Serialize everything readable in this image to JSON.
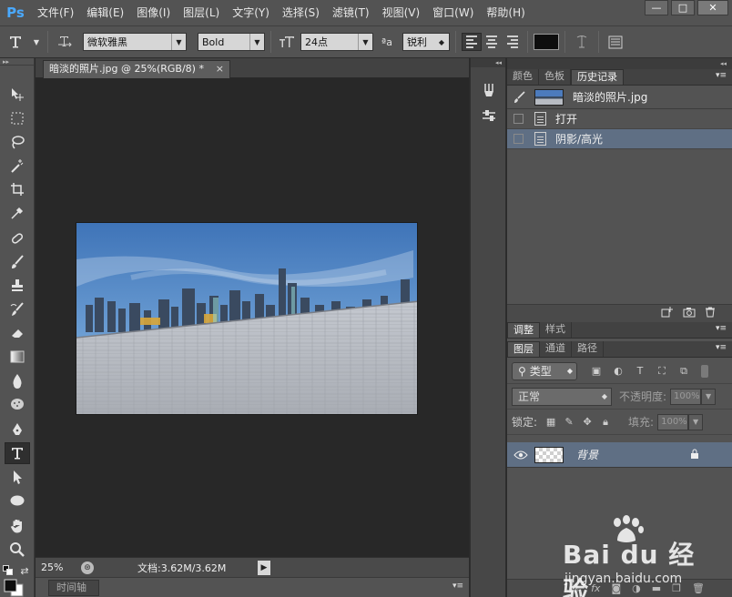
{
  "app": {
    "logo": "Ps"
  },
  "menu": [
    "文件(F)",
    "编辑(E)",
    "图像(I)",
    "图层(L)",
    "文字(Y)",
    "选择(S)",
    "滤镜(T)",
    "视图(V)",
    "窗口(W)",
    "帮助(H)"
  ],
  "window_controls": {
    "minimize": "—",
    "maximize": "□",
    "close": "✕"
  },
  "options": {
    "font_family": "微软雅黑",
    "font_style": "Bold",
    "font_size": "24点",
    "aa_label": "ªa",
    "antialias": "锐利",
    "text_color": "#0e0e0e"
  },
  "document": {
    "tab_title": "暗淡的照片.jpg @ 25%(RGB/8) *",
    "tab_close": "×",
    "zoom": "25%",
    "doc_size": "文档:3.62M/3.62M"
  },
  "timeline": {
    "label": "时间轴"
  },
  "history_panel": {
    "tabs": [
      "颜色",
      "色板",
      "历史记录"
    ],
    "active_tab": "历史记录",
    "snapshot": "暗淡的照片.jpg",
    "items": [
      {
        "label": "打开",
        "selected": false
      },
      {
        "label": "阴影/高光",
        "selected": true
      }
    ]
  },
  "adjust_tabs": [
    "调整",
    "样式"
  ],
  "layers_panel": {
    "tabs": [
      "图层",
      "通道",
      "路径"
    ],
    "filter_type": "类型",
    "blend_mode": "正常",
    "opacity_label": "不透明度:",
    "opacity_value": "100%",
    "lock_label": "锁定:",
    "fill_label": "填充:",
    "fill_value": "100%",
    "layers": [
      {
        "name": "背景",
        "visible": true,
        "locked": true
      }
    ],
    "footer_icons": [
      "link-icon",
      "fx-icon",
      "mask-icon",
      "adjustment-icon",
      "group-icon",
      "new-layer-icon",
      "trash-icon"
    ]
  },
  "watermark": {
    "brand": "Bai du 经验",
    "url": "jingyan.baidu.com"
  }
}
